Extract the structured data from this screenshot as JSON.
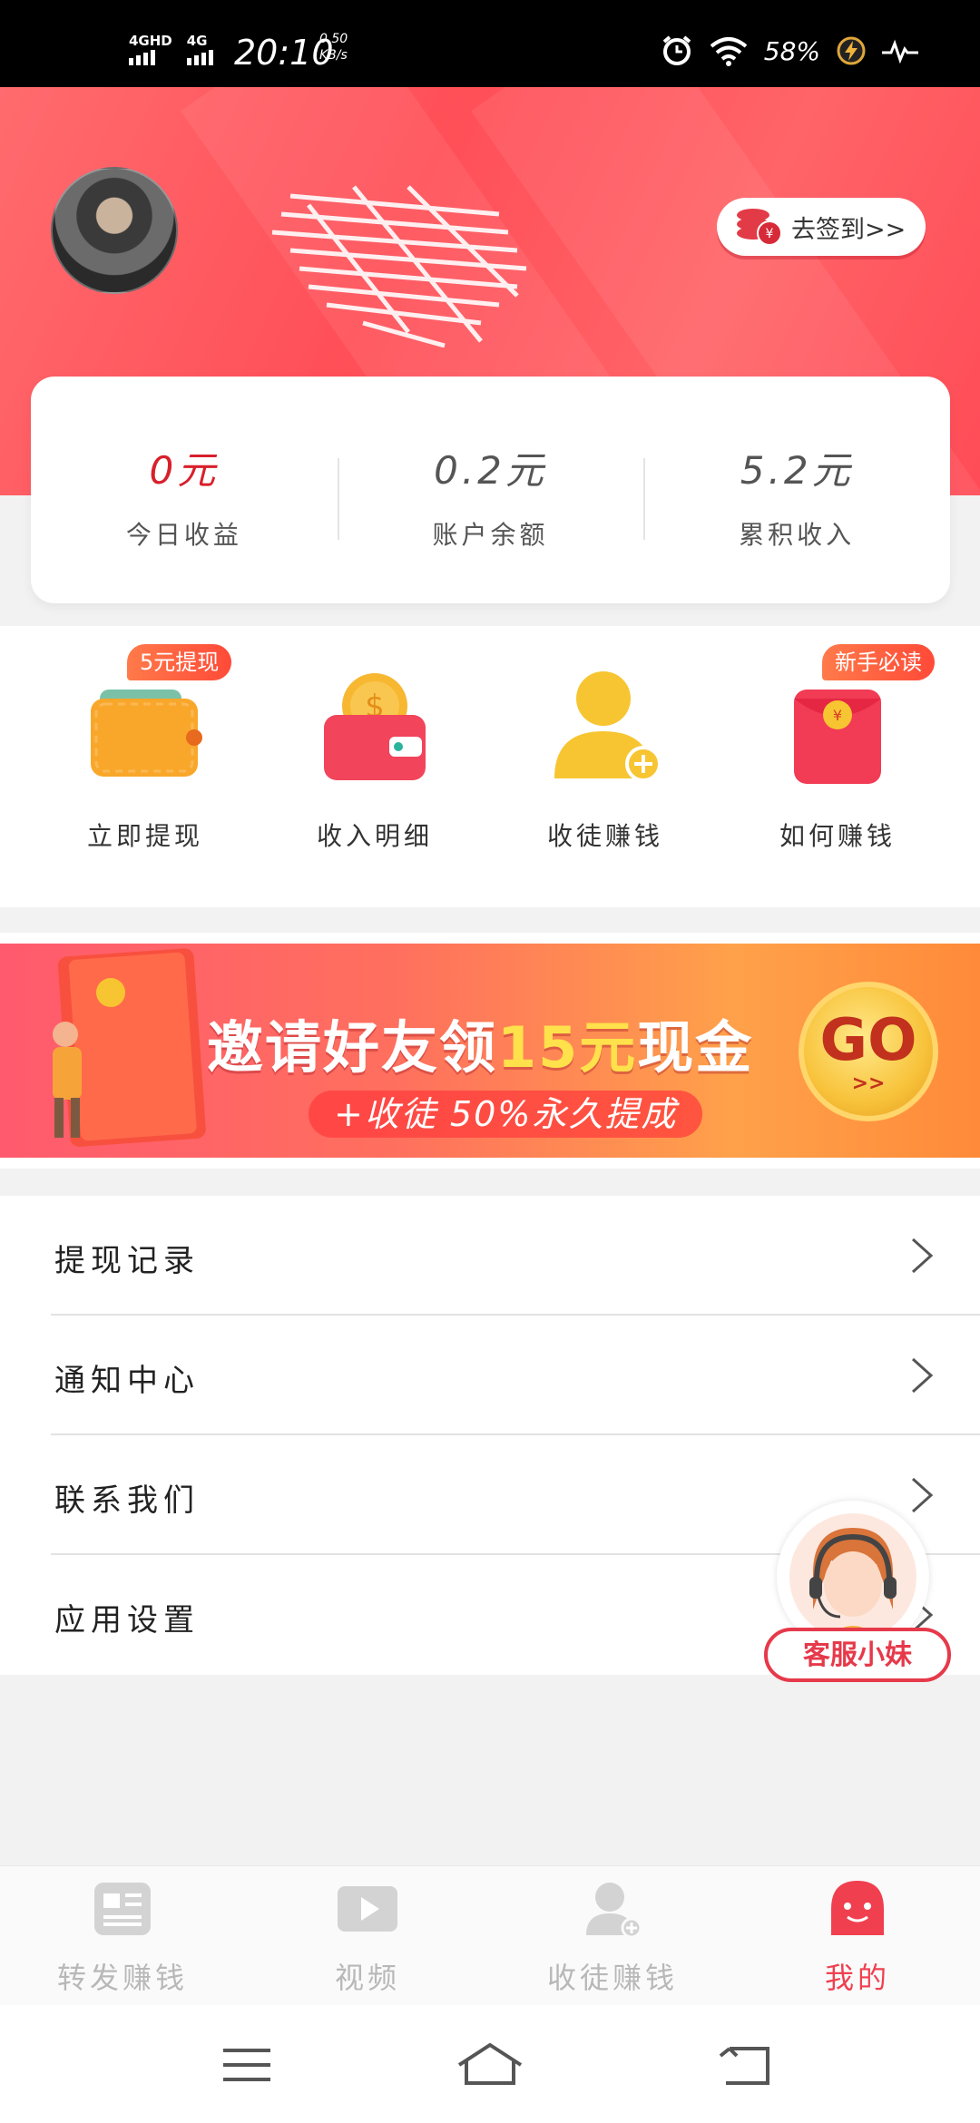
{
  "status_bar": {
    "network": [
      "4GHD",
      "4G"
    ],
    "time": "20:10",
    "speed_value": "0.50",
    "speed_unit": "KB/s",
    "battery": "58%"
  },
  "header": {
    "signin_label": "去签到>>"
  },
  "stats": [
    {
      "value": "0元",
      "label": "今日收益"
    },
    {
      "value": "0.2元",
      "label": "账户余额"
    },
    {
      "value": "5.2元",
      "label": "累积收入"
    }
  ],
  "actions": [
    {
      "label": "立即提现",
      "badge": "5元提现",
      "icon": "wallet-icon"
    },
    {
      "label": "收入明细",
      "badge": "",
      "icon": "coin-purse-icon"
    },
    {
      "label": "收徒赚钱",
      "badge": "",
      "icon": "add-user-icon"
    },
    {
      "label": "如何赚钱",
      "badge": "新手必读",
      "icon": "red-envelope-icon"
    }
  ],
  "banner": {
    "title_a": "邀请好友领",
    "title_b": "15元",
    "title_c": "现金",
    "subtitle": "+收徒 50%永久提成",
    "go": "GO",
    "go_arrow": ">>"
  },
  "menu": [
    {
      "label": "提现记录"
    },
    {
      "label": "通知中心"
    },
    {
      "label": "联系我们"
    },
    {
      "label": "应用设置"
    }
  ],
  "service": {
    "label": "客服小妹"
  },
  "tabs": [
    {
      "label": "转发赚钱",
      "icon": "article-icon"
    },
    {
      "label": "视频",
      "icon": "video-play-icon"
    },
    {
      "label": "收徒赚钱",
      "icon": "add-user-icon"
    },
    {
      "label": "我的",
      "icon": "smile-face-icon",
      "active": true
    }
  ],
  "colors": {
    "accent": "#f04050",
    "header": "#ff5a60",
    "muted": "#b8b8b8"
  }
}
